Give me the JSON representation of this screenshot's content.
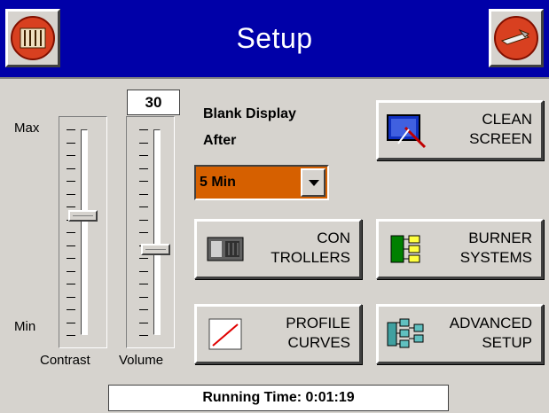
{
  "header": {
    "title": "Setup",
    "left_icon": "controller-icon",
    "right_icon": "exit-icon",
    "bar_color": "#0000a8"
  },
  "contrast": {
    "max_label": "Max",
    "min_label": "Min",
    "label": "Contrast",
    "level": 0.42
  },
  "volume": {
    "value": "30",
    "label": "Volume",
    "level": 0.58
  },
  "blank_display": {
    "label_line1": "Blank Display",
    "label_line2": "After",
    "selected": "5 Min",
    "color": "#d66000"
  },
  "buttons": {
    "clean_screen": "CLEAN\nSCREEN",
    "controllers": "CON\nTROLLERS",
    "burner_systems": "BURNER\nSYSTEMS",
    "profile_curves": "PROFILE\nCURVES",
    "advanced_setup": "ADVANCED\nSETUP"
  },
  "status": {
    "running_time": "Running Time: 0:01:19"
  }
}
